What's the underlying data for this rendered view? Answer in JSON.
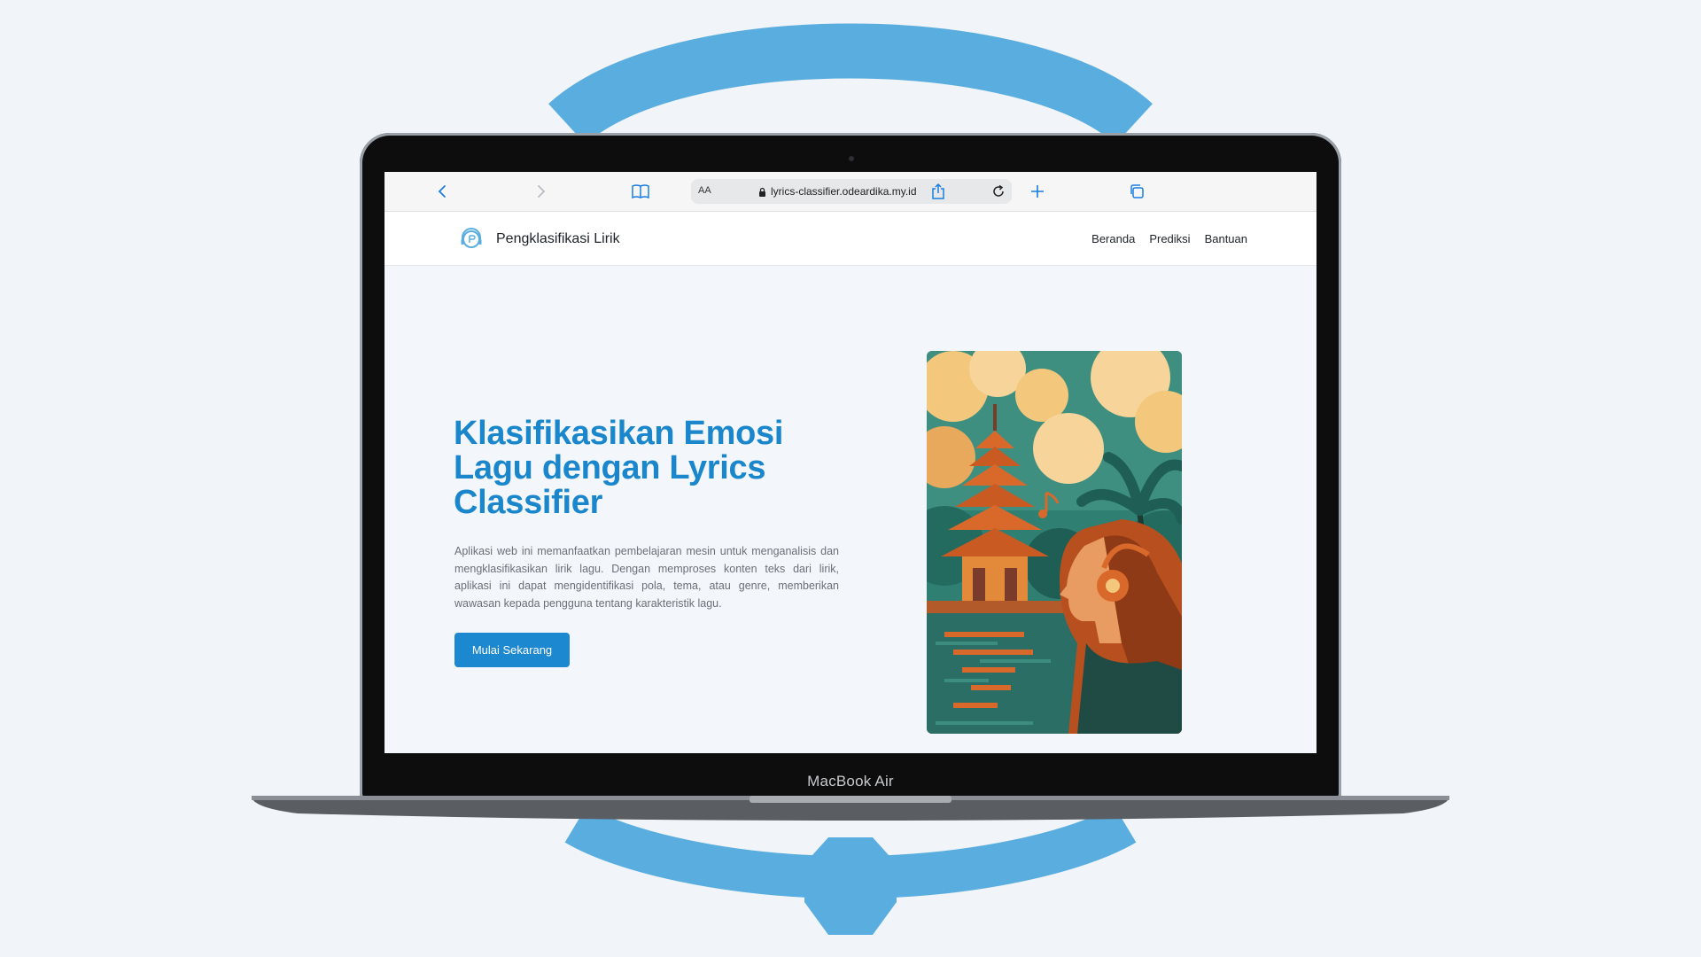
{
  "colors": {
    "accent": "#1a86cc",
    "ring": "#5aaedf",
    "background": "#f1f4f8",
    "button": "#1c88d0"
  },
  "laptop": {
    "model_label": "MacBook Air"
  },
  "browser": {
    "text_size_label": "AA",
    "url": "lyrics-classifier.odeardika.my.id",
    "icons": [
      "back-icon",
      "forward-icon",
      "bookmarks-icon",
      "lock-icon",
      "reload-icon",
      "share-icon",
      "new-tab-icon",
      "tabs-icon"
    ]
  },
  "site": {
    "brand_name": "Pengklasifikasi Lirik",
    "nav": [
      "Beranda",
      "Prediksi",
      "Bantuan"
    ]
  },
  "hero": {
    "title_lines": [
      "Klasifikasikan Emosi",
      "Lagu dengan Lyrics",
      "Classifier"
    ],
    "description": "Aplikasi web ini memanfaatkan pembelajaran mesin untuk menganalisis dan mengklasifikasikan lirik lagu. Dengan memproses konten teks dari lirik, aplikasi ini dapat mengidentifikasi pola, tema, atau genre, memberikan wawasan kepada pengguna tentang karakteristik lagu.",
    "cta_label": "Mulai Sekarang"
  }
}
